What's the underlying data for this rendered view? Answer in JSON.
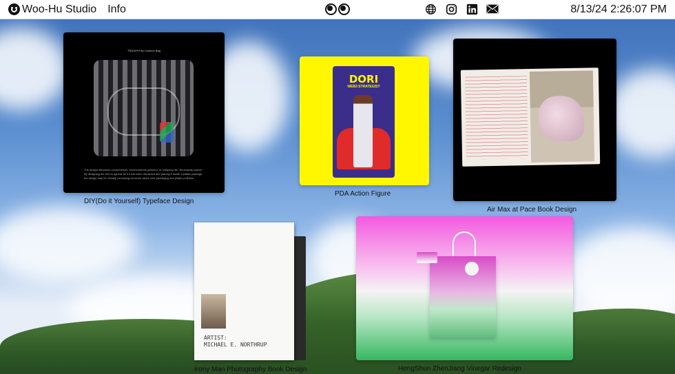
{
  "topbar": {
    "brand": "Woo-Hu Studio",
    "info_label": "Info",
    "clock": "8/13/24 2:26:07 PM",
    "icons": [
      "globe-icon",
      "instagram-icon",
      "linkedin-icon",
      "mail-icon"
    ]
  },
  "projects": [
    {
      "caption": "DIY(Do it Yourself) Typeface Design",
      "top_text": "TRASH*H Air Cushion Bag",
      "body_text": "The design discusses consumerism, environmental pollution, or critiquing the \"throwaway culture.\" By designing the font to appear as if it has been discarded and placing it inside a plastic package, the design may be visually conveying concerns about over-packaging and plastic pollution."
    },
    {
      "caption": "PDA Action Figure",
      "pkg_title": "DORI",
      "pkg_sub": "WEB3 STRATEGIST"
    },
    {
      "caption": "Air Max at Pace Book Design"
    },
    {
      "caption": "Irony Man Photography Book Design",
      "artist_label": "ARTIST:",
      "artist_name": "MICHAEL E. NORTHRUP"
    },
    {
      "caption": "HengShun ZhenJiang Vinegar Redesign"
    }
  ]
}
